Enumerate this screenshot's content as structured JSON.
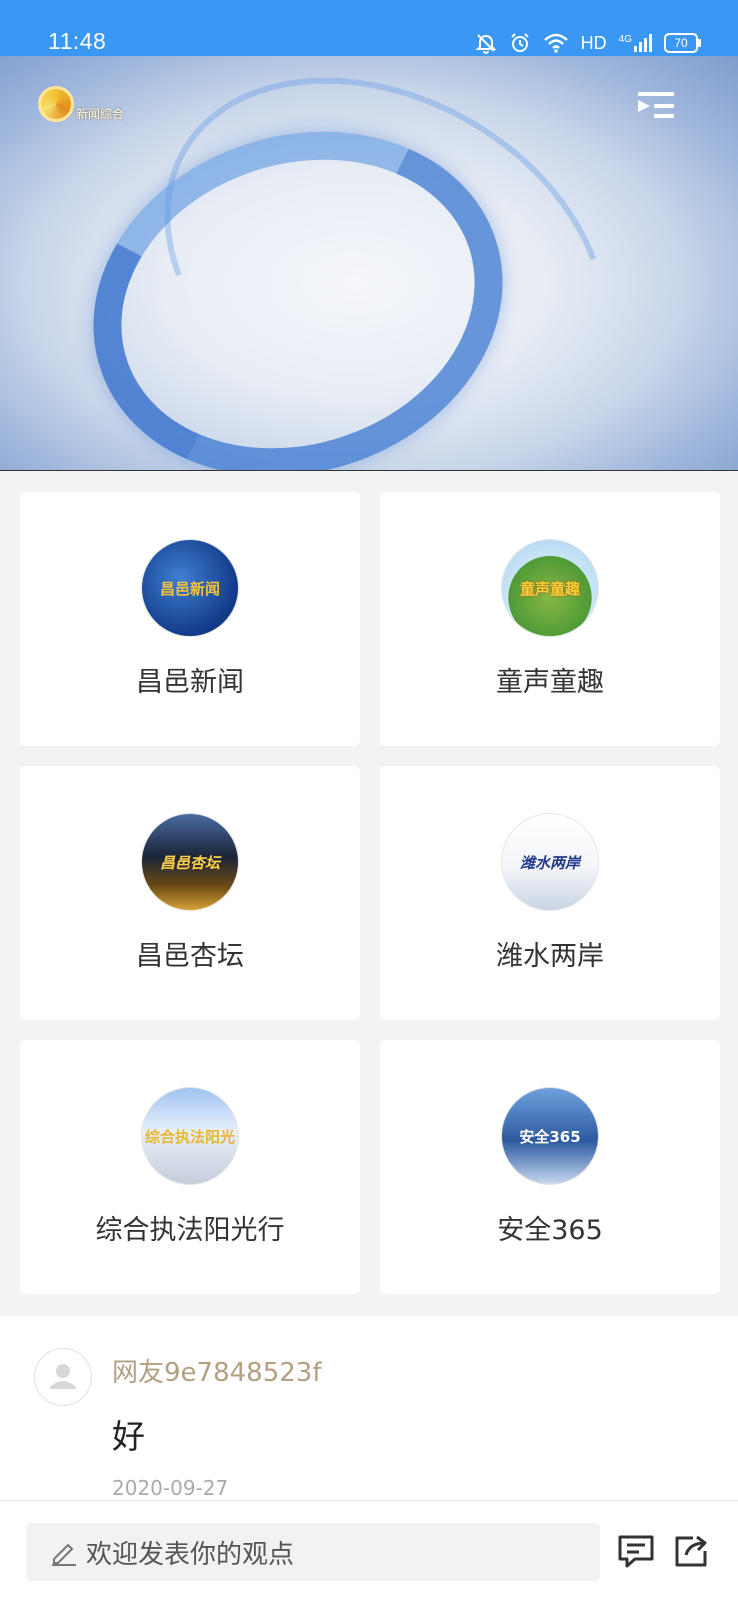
{
  "status_bar": {
    "time": "11:48",
    "network": "HD",
    "signal_type": "4G",
    "battery": "70"
  },
  "video": {
    "channel_logo_text": "新闻综合",
    "playlist_icon": "playlist-icon"
  },
  "programs": [
    {
      "title": "昌邑新闻",
      "thumb_text": "昌邑新闻"
    },
    {
      "title": "童声童趣",
      "thumb_text": "童声童趣"
    },
    {
      "title": "昌邑杏坛",
      "thumb_text": "昌邑杏坛"
    },
    {
      "title": "潍水两岸",
      "thumb_text": "潍水两岸"
    },
    {
      "title": "综合执法阳光行",
      "thumb_text": "综合执法阳光"
    },
    {
      "title": "安全365",
      "thumb_text": "安全365"
    }
  ],
  "comment": {
    "username": "网友9e7848523f",
    "content": "好",
    "date": "2020-09-27"
  },
  "bottom_bar": {
    "input_placeholder": "欢迎发表你的观点",
    "comment_icon": "comment-icon",
    "share_icon": "share-icon"
  },
  "colors": {
    "status_bar": "#3a97f4",
    "username": "#b3a082"
  }
}
